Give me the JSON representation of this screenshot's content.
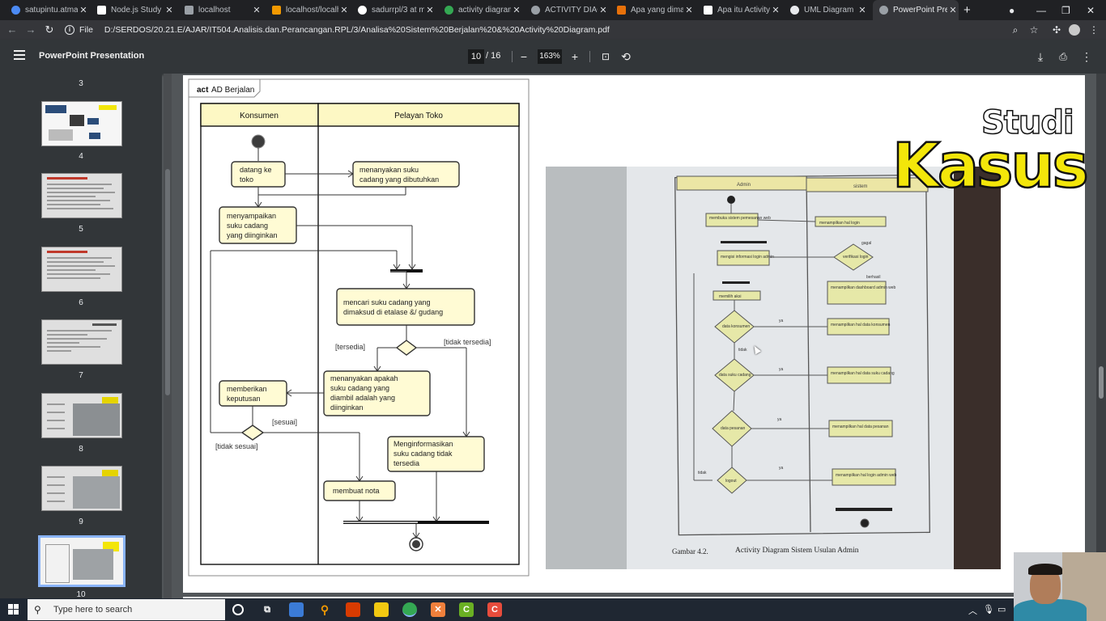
{
  "browser": {
    "tabs": [
      {
        "title": "satupintu.atmaj",
        "color": "#4c8bf5"
      },
      {
        "title": "Node.js Study |",
        "color": "#ffffff"
      },
      {
        "title": "localhost",
        "color": "#9aa0a6"
      },
      {
        "title": "localhost/localh",
        "color": "#f29900"
      },
      {
        "title": "sadurrpl/3 at m",
        "color": "#ffffff"
      },
      {
        "title": "activity diagram",
        "color": "#34a853"
      },
      {
        "title": "ACTIVITY DIAGR",
        "color": "#9aa0a6"
      },
      {
        "title": "Apa yang dimak",
        "color": "#e8710a"
      },
      {
        "title": "Apa itu Activity",
        "color": "#ffffff"
      },
      {
        "title": "UML Diagram :",
        "color": "#e8eaed"
      },
      {
        "title": "PowerPoint Pres",
        "color": "#9aa0a6"
      }
    ],
    "new_tab": "+",
    "url_scheme": "File",
    "url": "D:/SERDOS/20.21.E/AJAR/IT504.Analisis.dan.Perancangan.RPL/3/Analisa%20Sistem%20Berjalan%20&%20Activity%20Diagram.pdf"
  },
  "pdf": {
    "title": "PowerPoint Presentation",
    "current_page": "10",
    "total_pages": "/ 16",
    "zoom": "163%"
  },
  "sidebar": {
    "page_numbers": [
      "3",
      "4",
      "5",
      "6",
      "7",
      "8",
      "9",
      "10"
    ]
  },
  "slide": {
    "frame_label_bold": "act",
    "frame_label": "AD Berjalan",
    "lanes": [
      "Konsumen",
      "Pelayan Toko"
    ],
    "nodes": {
      "datang": [
        "datang ke",
        "toko"
      ],
      "menanyakan_suku": [
        "menanyakan suku",
        "cadang yang dibutuhkan"
      ],
      "menyampaikan": [
        "menyampaikan",
        "suku cadang",
        "yang diinginkan"
      ],
      "mencari": [
        "mencari suku cadang yang",
        "dimaksud di etalase &/ gudang"
      ],
      "menanyakan_apakah": [
        "menanyakan apakah",
        "suku cadang yang",
        "diambil adalah yang",
        "diinginkan"
      ],
      "memberikan": [
        "memberikan",
        "keputusan"
      ],
      "menginformasikan": [
        "Menginformasikan",
        "suku cadang tidak",
        "tersedia"
      ],
      "membuat_nota": [
        "membuat nota"
      ]
    },
    "guards": {
      "tersedia": "[tersedia]",
      "tidak_tersedia": "[tidak tersedia]",
      "sesuai": "[sesuai]",
      "tidak_sesuai": "[tidak sesuai]"
    },
    "overlay_title_1": "Studi",
    "overlay_title_2": "Kasus",
    "photo": {
      "lanes": [
        "Admin",
        "sistem"
      ],
      "nodes": [
        "membuka sistem pemesanan web",
        "menampilkan hal login",
        "mengisi informasi login admin",
        "verifikasi login",
        "menampilkan dashboard admin web",
        "memilih aksi",
        "data konsumen",
        "menampilkan hal data konsumen",
        "data suku cadang",
        "menampilkan hal data suku cadang",
        "data pesanan",
        "menampilkan hal data pesanan",
        "logout",
        "menampilkan hal login admin web"
      ],
      "guards": [
        "gagal",
        "berhasil",
        "ya",
        "tidak"
      ],
      "caption": "Gambar 4.2.",
      "caption_title": "Activity Diagram Sistem Usulan Admin"
    }
  },
  "taskbar": {
    "search_placeholder": "Type here to search"
  }
}
